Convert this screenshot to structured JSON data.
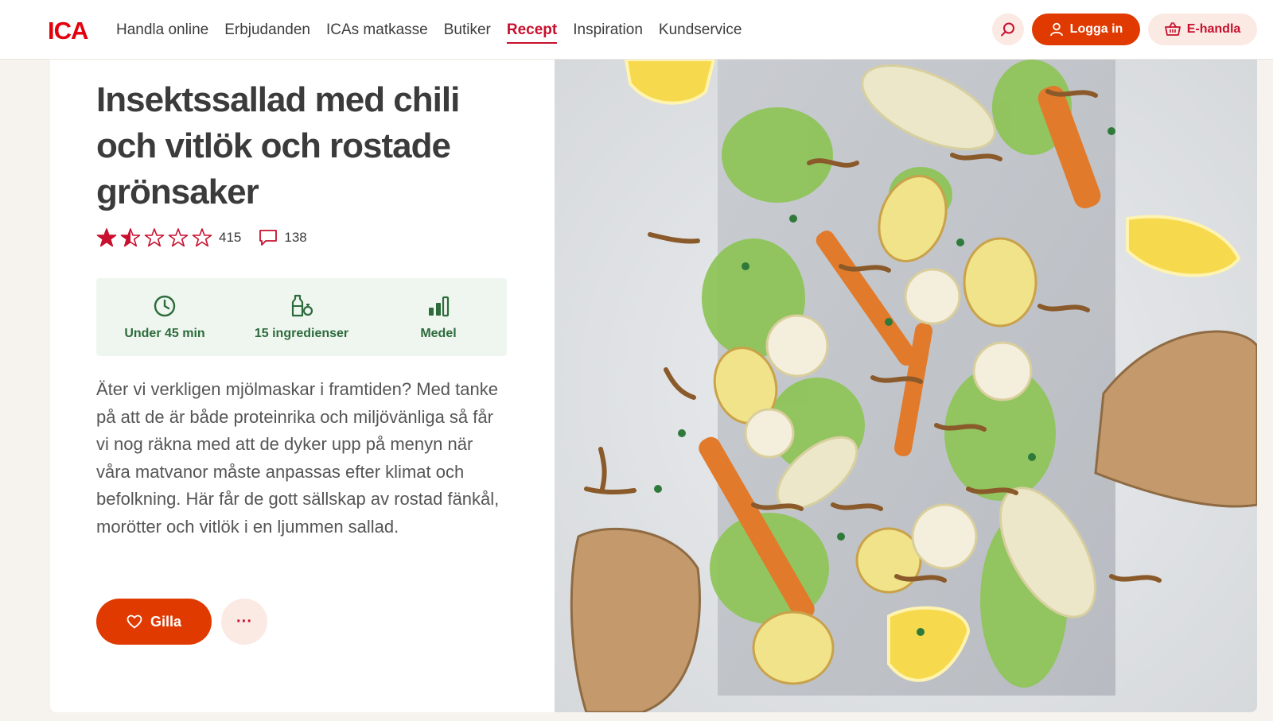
{
  "header": {
    "logo_text": "ICA",
    "nav": [
      {
        "label": "Handla online",
        "active": false
      },
      {
        "label": "Erbjudanden",
        "active": false
      },
      {
        "label": "ICAs matkasse",
        "active": false
      },
      {
        "label": "Butiker",
        "active": false
      },
      {
        "label": "Recept",
        "active": true
      },
      {
        "label": "Inspiration",
        "active": false
      },
      {
        "label": "Kundservice",
        "active": false
      }
    ],
    "search_icon": "search-icon",
    "login_label": "Logga in",
    "login_icon": "user-icon",
    "ehandla_label": "E-handla",
    "ehandla_icon": "basket-icon"
  },
  "recipe": {
    "title": "Insektssallad med chili och vitlök och rostade grönsaker",
    "rating": {
      "value": 1.5,
      "max": 5,
      "count": "415"
    },
    "comments": {
      "count": "138",
      "icon": "comment-icon"
    },
    "facts": [
      {
        "icon": "clock-icon",
        "label": "Under 45 min"
      },
      {
        "icon": "ingredients-icon",
        "label": "15 ingredienser"
      },
      {
        "icon": "difficulty-icon",
        "label": "Medel"
      }
    ],
    "description": "Äter vi verkligen mjölmaskar i framtiden? Med tanke på att de är både proteinrika och miljövänliga så får vi nog räkna med att de dyker upp på menyn när våra matvanor måste anpassas efter klimat och befolkning. Här får de gott sällskap av rostad fänkål, morötter och vitlök i en ljummen sallad.",
    "like_label": "Gilla",
    "like_icon": "heart-icon",
    "more_label": "···"
  },
  "colors": {
    "brand_red": "#c8102e",
    "button_orange": "#e03a00",
    "button_pink": "#fbe9e3",
    "facts_green_bg": "#eef6ef",
    "facts_green_text": "#2d6b3c"
  }
}
